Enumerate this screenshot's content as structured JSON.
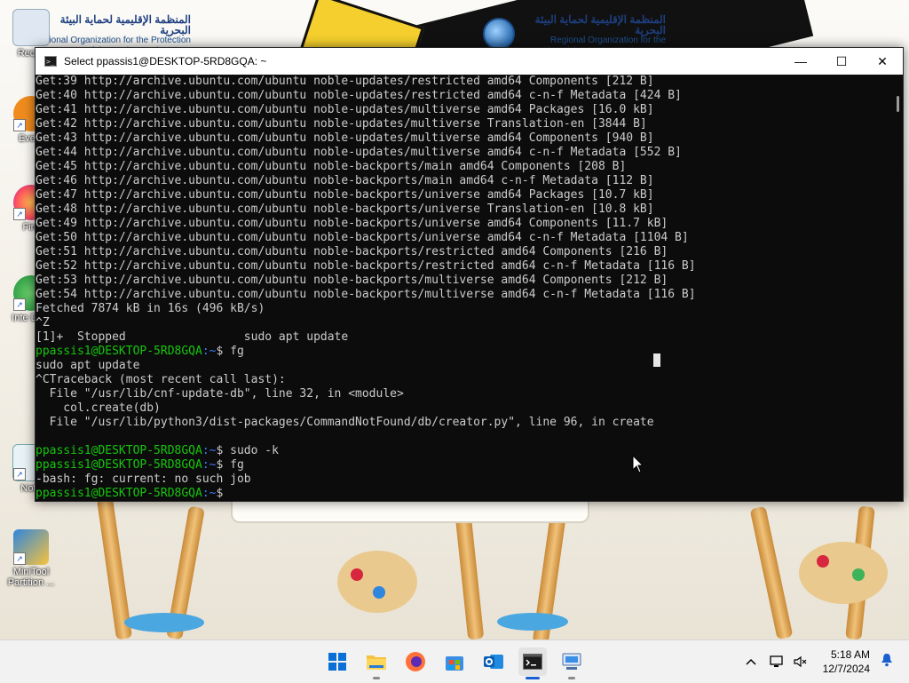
{
  "desktop": {
    "logo_ar": "المنظمة الإقليمية لحماية البيئة البحرية",
    "logo_en": "Regional Organization for the Protection of the Marine Environment",
    "icons": [
      {
        "label": "Recyc",
        "icon": "recycle-bin-icon"
      },
      {
        "label": "Every",
        "icon": "everything-search-icon"
      },
      {
        "label": "Fire",
        "icon": "firefox-icon"
      },
      {
        "label": "Inte Dow",
        "icon": "internet-download-manager-icon"
      },
      {
        "label": "Note",
        "icon": "notepad-icon"
      },
      {
        "label": "MiniTool Partition ...",
        "icon": "minitool-partition-icon"
      }
    ]
  },
  "window": {
    "title": "Select ppassis1@DESKTOP-5RD8GQA: ~",
    "controls": {
      "minimize": "—",
      "maximize": "☐",
      "close": "✕"
    }
  },
  "terminal": {
    "lines": [
      "Get:39 http://archive.ubuntu.com/ubuntu noble-updates/restricted amd64 Components [212 B]",
      "Get:40 http://archive.ubuntu.com/ubuntu noble-updates/restricted amd64 c-n-f Metadata [424 B]",
      "Get:41 http://archive.ubuntu.com/ubuntu noble-updates/multiverse amd64 Packages [16.0 kB]",
      "Get:42 http://archive.ubuntu.com/ubuntu noble-updates/multiverse Translation-en [3844 B]",
      "Get:43 http://archive.ubuntu.com/ubuntu noble-updates/multiverse amd64 Components [940 B]",
      "Get:44 http://archive.ubuntu.com/ubuntu noble-updates/multiverse amd64 c-n-f Metadata [552 B]",
      "Get:45 http://archive.ubuntu.com/ubuntu noble-backports/main amd64 Components [208 B]",
      "Get:46 http://archive.ubuntu.com/ubuntu noble-backports/main amd64 c-n-f Metadata [112 B]",
      "Get:47 http://archive.ubuntu.com/ubuntu noble-backports/universe amd64 Packages [10.7 kB]",
      "Get:48 http://archive.ubuntu.com/ubuntu noble-backports/universe Translation-en [10.8 kB]",
      "Get:49 http://archive.ubuntu.com/ubuntu noble-backports/universe amd64 Components [11.7 kB]",
      "Get:50 http://archive.ubuntu.com/ubuntu noble-backports/universe amd64 c-n-f Metadata [1104 B]",
      "Get:51 http://archive.ubuntu.com/ubuntu noble-backports/restricted amd64 Components [216 B]",
      "Get:52 http://archive.ubuntu.com/ubuntu noble-backports/restricted amd64 c-n-f Metadata [116 B]",
      "Get:53 http://archive.ubuntu.com/ubuntu noble-backports/multiverse amd64 Components [212 B]",
      "Get:54 http://archive.ubuntu.com/ubuntu noble-backports/multiverse amd64 c-n-f Metadata [116 B]",
      "Fetched 7874 kB in 16s (496 kB/s)",
      "^Z",
      "[1]+  Stopped                 sudo apt update",
      {
        "user": "ppassis1@DESKTOP-5RD8GQA",
        "path": ":~",
        "cmd": "$ fg"
      },
      "sudo apt update",
      "^CTraceback (most recent call last):",
      "  File \"/usr/lib/cnf-update-db\", line 32, in <module>",
      "    col.create(db)",
      "  File \"/usr/lib/python3/dist-packages/CommandNotFound/db/creator.py\", line 96, in create",
      "",
      {
        "user": "ppassis1@DESKTOP-5RD8GQA",
        "path": ":~",
        "cmd": "$ sudo -k"
      },
      {
        "user": "ppassis1@DESKTOP-5RD8GQA",
        "path": ":~",
        "cmd": "$ fg"
      },
      "-bash: fg: current: no such job",
      {
        "user": "ppassis1@DESKTOP-5RD8GQA",
        "path": ":~",
        "cmd": "$"
      }
    ],
    "colors": {
      "background": "#0c0c0c",
      "text": "#cccccc",
      "user": "#16c60c",
      "path": "#3b78ff"
    }
  },
  "taskbar": {
    "apps": [
      {
        "name": "start-button",
        "icon": "windows-start-icon"
      },
      {
        "name": "file-explorer",
        "icon": "folder-icon"
      },
      {
        "name": "firefox",
        "icon": "firefox-icon"
      },
      {
        "name": "microsoft-store",
        "icon": "store-icon"
      },
      {
        "name": "outlook-new",
        "icon": "outlook-icon"
      },
      {
        "name": "terminal",
        "icon": "terminal-icon",
        "active": true
      },
      {
        "name": "remote-desktop",
        "icon": "remote-desktop-icon"
      }
    ],
    "tray": {
      "chevron": "^",
      "time": "5:18 AM",
      "date": "12/7/2024"
    }
  }
}
